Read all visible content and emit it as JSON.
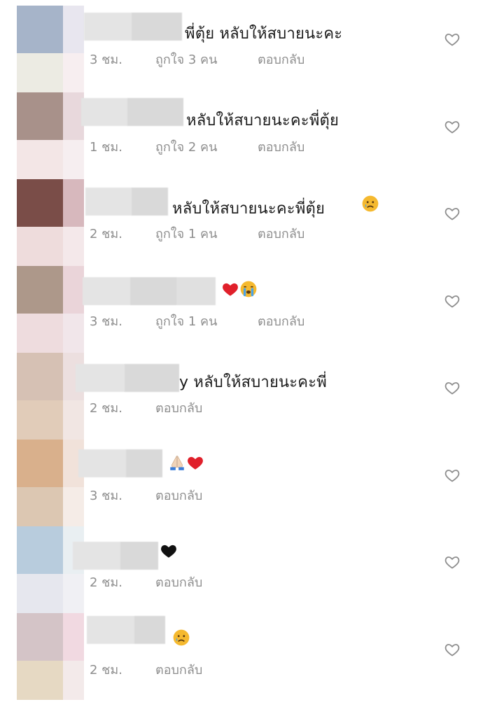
{
  "comments": [
    {
      "text": "พี่ตุ้ย หลับให้สบายนะคะ",
      "time": "3 ชม.",
      "likes": "ถูกใจ 3 คน",
      "reply": "ตอบกลับ",
      "emoji": []
    },
    {
      "text": "หลับให้สบายนะคะพี่ตุ้ย",
      "time": "1 ชม.",
      "likes": "ถูกใจ 2 คน",
      "reply": "ตอบกลับ",
      "emoji": []
    },
    {
      "text": "หลับให้สบายนะคะพี่ตุ้ย",
      "time": "2 ชม.",
      "likes": "ถูกใจ 1 คน",
      "reply": "ตอบกลับ",
      "emoji": [
        "sad-tear-emoji"
      ]
    },
    {
      "text": "",
      "time": "3 ชม.",
      "likes": "ถูกใจ 1 คน",
      "reply": "ตอบกลับ",
      "emoji": [
        "red-heart-emoji",
        "crying-emoji"
      ]
    },
    {
      "text": "y หลับให้สบายนะคะพี่",
      "time": "2 ชม.",
      "likes": "",
      "reply": "ตอบกลับ",
      "emoji": []
    },
    {
      "text": "",
      "time": "3 ชม.",
      "likes": "",
      "reply": "ตอบกลับ",
      "emoji": [
        "folded-hands-emoji",
        "red-heart-emoji"
      ]
    },
    {
      "text": "",
      "time": "2 ชม.",
      "likes": "",
      "reply": "ตอบกลับ",
      "emoji": [
        "black-heart-emoji"
      ]
    },
    {
      "text": "",
      "time": "2 ชม.",
      "likes": "",
      "reply": "ตอบกลับ",
      "emoji": [
        "sad-tear-emoji"
      ]
    }
  ],
  "colors": {
    "text": "#1a1a1a",
    "meta": "#8e8e8e",
    "heart_outline": "#8e8e8e",
    "heart_red": "#e0202b",
    "tear_face": "#f5b92f"
  },
  "icons": {
    "like": "heart-outline-icon"
  }
}
